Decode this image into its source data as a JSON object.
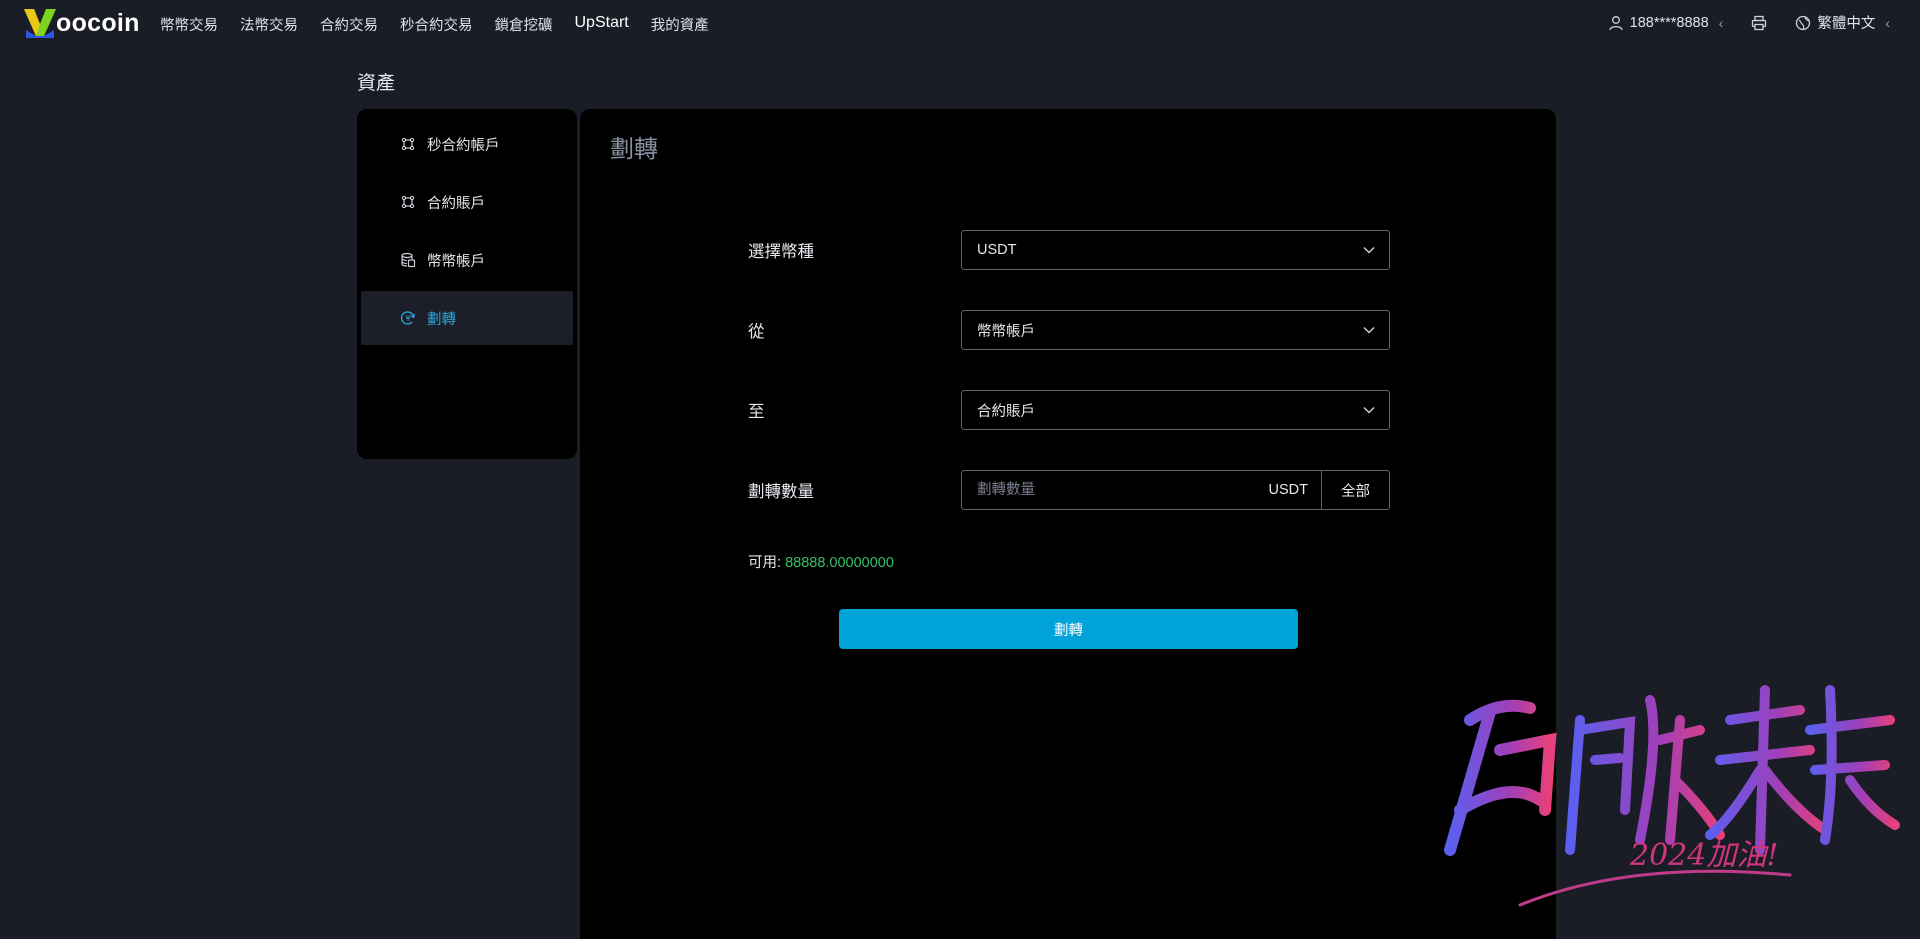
{
  "brand": {
    "logo_text": "oocoin"
  },
  "nav": {
    "items": [
      {
        "label": "幣幣交易"
      },
      {
        "label": "法幣交易"
      },
      {
        "label": "合約交易"
      },
      {
        "label": "秒合約交易"
      },
      {
        "label": "鎖倉挖礦"
      },
      {
        "label": "UpStart"
      },
      {
        "label": "我的資產"
      }
    ],
    "user": "188****8888",
    "language": "繁體中文"
  },
  "page": {
    "title": "資產"
  },
  "sidebar": {
    "items": [
      {
        "label": "秒合約帳戶",
        "icon": "contract-icon"
      },
      {
        "label": "合約賬戶",
        "icon": "contract-icon"
      },
      {
        "label": "幣幣帳戶",
        "icon": "coins-icon"
      },
      {
        "label": "劃轉",
        "icon": "transfer-icon",
        "active": true
      }
    ]
  },
  "transfer": {
    "title": "劃轉",
    "currency_label": "選擇幣種",
    "currency_value": "USDT",
    "from_label": "從",
    "from_value": "幣幣帳戶",
    "to_label": "至",
    "to_value": "合約賬戶",
    "amount_label": "劃轉數量",
    "amount_placeholder": "劃轉數量",
    "amount_unit": "USDT",
    "all_label": "全部",
    "available_label": "可用:",
    "available_value": "88888.00000000",
    "submit_label": "劃轉"
  },
  "watermark": {
    "text": "启航未来",
    "subtext": "2024加油!"
  },
  "colors": {
    "background": "#1a1d26",
    "panel": "#000000",
    "accent": "#00a3d9",
    "active_text": "#2ba8d8",
    "available_green": "#35c06a"
  }
}
